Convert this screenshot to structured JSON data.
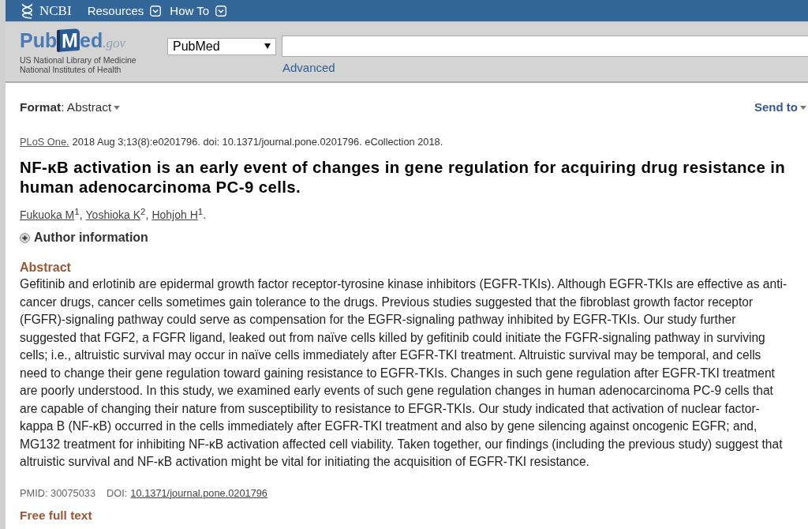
{
  "top_bar": {
    "brand": "NCBI",
    "menus": [
      {
        "label": "Resources"
      },
      {
        "label": "How To"
      }
    ]
  },
  "header": {
    "logo": {
      "start": "Pub",
      "mark": "M",
      "end": "ed",
      "suffix": ".gov"
    },
    "agency_lines": [
      "US National Library of Medicine",
      "National Institutes of Health"
    ],
    "search": {
      "database": "PubMed",
      "advanced_link": "Advanced"
    }
  },
  "toolbar": {
    "format": "**Format**: Abstract",
    "send_to": "Send to"
  },
  "citation": {
    "journal": "PLoS One.",
    "details": "2018 Aug 3;13(8):e0201796. doi: 10.1371/journal.pone.0201796. eCollection 2018."
  },
  "title": "NF-κB activation is an early event of changes in gene regulation for acquiring drug resistance in human adenocarcinoma PC-9 cells.",
  "authors": [
    {
      "name": "Fukuoka M",
      "affiliation": "1",
      "separator": ","
    },
    {
      "name": "Yoshioka K",
      "affiliation": "2",
      "separator": ","
    },
    {
      "name": "Hohjoh H",
      "affiliation": "1",
      "separator": "."
    }
  ],
  "author_information": {
    "label": "Author information",
    "expanded": false
  },
  "abstract": {
    "heading": "Abstract",
    "text": "Gefitinib and erlotinib are epidermal growth factor receptor-tyrosine kinase inhibitors (EGFR-TKIs). Although EGFR-TKIs are effective as anti-cancer drugs, cancer cells sometimes gain tolerance to the drugs. Previous studies suggested that the fibroblast growth factor receptor (FGFR)-signaling pathway could serve as compensation for the EGFR-signaling pathway inhibited by EGFR-TKIs. Our study further suggested that FGF2, a FGFR ligand, leaked out from naïve cells killed by gefitinib could initiate the FGFR-signaling pathway in surviving cells; i.e., altruistic survival may occur in naïve cells immediately after EGFR-TKI treatment. Altruistic survival may be temporal, and cells need to change their gene regulation toward gaining resistance to EGFR-TKIs. Changes in such gene regulation after EGFR-TKI treatment are poorly understood. In this study, we examined early events of such gene regulation changes in human adenocarcinoma PC-9 cells that are capable of changing their nature from susceptibility to resistance to EFGR-TKIs. Our study indicated that activation of nuclear factor-kappa B (NF-κB) occurred in the cells immediately after EGFR-TKI treatment and also by gene silencing against oncogenic EGFR; and, MG132 treatment for inhibiting NF-κB activation affected cell viability. Taken together, our findings (including the previous study) suggest that altruistic survival and NF-κB activation might be vital for initiating the acquisition of EGFR-TKI resistance."
  },
  "identifiers": {
    "pmid": "PMID: 30075033",
    "doi_label": "DOI:",
    "doi": "10.1371/journal.pone.0201796"
  },
  "full_text": {
    "heading": "Free full text"
  }
}
